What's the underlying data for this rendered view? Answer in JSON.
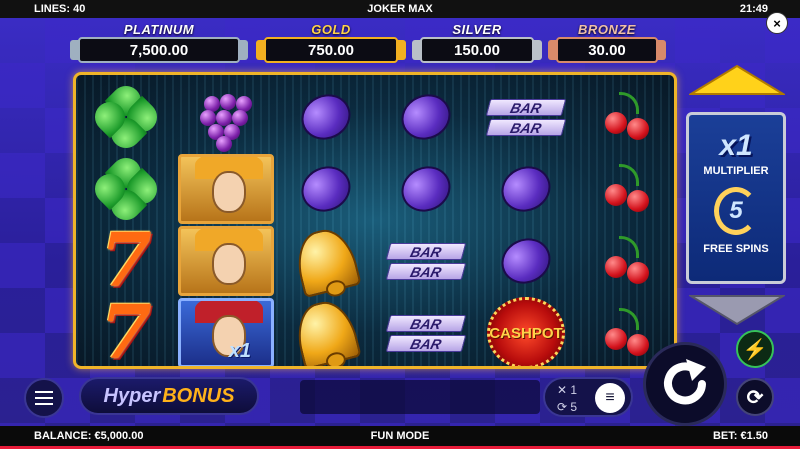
{
  "topbar": {
    "lines": "LINES: 40",
    "title": "JOKER MAX",
    "clock": "21:49",
    "close": "×"
  },
  "jackpots": [
    {
      "name": "PLATINUM",
      "value": "7,500.00",
      "color": "#9fb0c0"
    },
    {
      "name": "GOLD",
      "value": "750.00",
      "color": "#f2b021"
    },
    {
      "name": "SILVER",
      "value": "150.00",
      "color": "#b9c0c8"
    },
    {
      "name": "BRONZE",
      "value": "30.00",
      "color": "#d88a6a"
    }
  ],
  "reels": {
    "symbols": [
      [
        "clover",
        "clover",
        "seven",
        "seven"
      ],
      [
        "grape",
        "joker-gold",
        "joker-gold",
        "joker-blue-x1"
      ],
      [
        "plum",
        "plum",
        "bell",
        "bell"
      ],
      [
        "plum",
        "plum",
        "bar",
        "bar"
      ],
      [
        "bar",
        "plum",
        "plum",
        "cashpot"
      ],
      [
        "cherry",
        "cherry",
        "cherry",
        "cherry"
      ]
    ],
    "bar_label": "BAR",
    "cashpot_label": "CASHPOT",
    "joker_multiplier": "x1"
  },
  "multiplier_panel": {
    "multiplier": "x1",
    "multiplier_label": "MULTIPLIER",
    "free_spins_count": "5",
    "free_spins_label": "FREE SPINS"
  },
  "controls": {
    "hyper_part1": "Hyper",
    "hyper_part2": "BONUS",
    "settings_lines": "✕ 1",
    "settings_spins": "⟳ 5",
    "turbo_icon": "⚡",
    "auto_icon": "⟳"
  },
  "statusbar": {
    "balance": "BALANCE: €5,000.00",
    "mode": "FUN MODE",
    "bet": "BET: €1.50"
  }
}
